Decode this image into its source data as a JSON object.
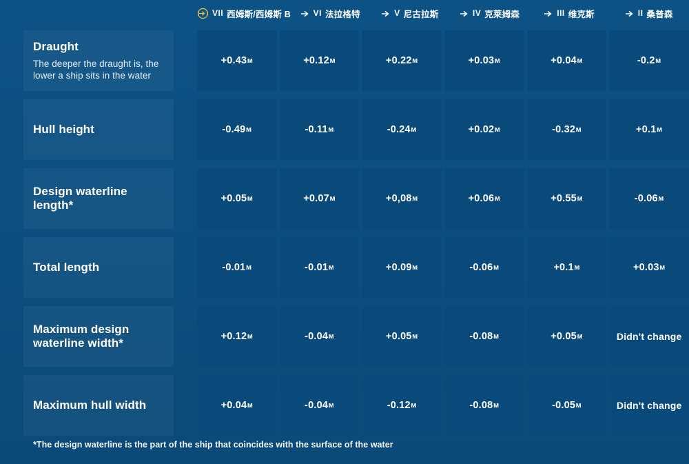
{
  "theme": {
    "background": "#0c4f80",
    "cell_background": "#0a4a7b",
    "label_background": "rgba(255,255,255,0.045)",
    "text": "#ffffff",
    "accent_gold": "#e8c14a"
  },
  "header": {
    "columns": [
      {
        "icon": "wreath-arrow-icon",
        "tier": "VII",
        "ship": "西姆斯/西姆斯 B"
      },
      {
        "icon": "arrow-right-icon",
        "tier": "VI",
        "ship": "法拉格特"
      },
      {
        "icon": "arrow-right-icon",
        "tier": "V",
        "ship": "尼古拉斯"
      },
      {
        "icon": "arrow-right-icon",
        "tier": "IV",
        "ship": "克莱姆森"
      },
      {
        "icon": "arrow-right-icon",
        "tier": "III",
        "ship": "维克斯"
      },
      {
        "icon": "arrow-right-icon",
        "tier": "II",
        "ship": "桑普森"
      }
    ]
  },
  "table": {
    "rows": [
      {
        "title": "Draught",
        "subtitle": "The deeper the draught is, the lower a ship sits in the water",
        "values": [
          "+0.43м",
          "+0.12м",
          "+0.22м",
          "+0.03м",
          "+0.04м",
          "-0.2м"
        ]
      },
      {
        "title": "Hull height",
        "subtitle": "",
        "values": [
          "-0.49м",
          "-0.11м",
          "-0.24м",
          "+0.02м",
          "-0.32м",
          "+0.1м"
        ]
      },
      {
        "title": "Design waterline length*",
        "subtitle": "",
        "values": [
          "+0.05м",
          "+0.07м",
          "+0,08м",
          "+0.06м",
          "+0.55м",
          "-0.06м"
        ]
      },
      {
        "title": "Total length",
        "subtitle": "",
        "values": [
          "-0.01м",
          "-0.01м",
          "+0.09м",
          "-0.06м",
          "+0.1м",
          "+0.03м"
        ]
      },
      {
        "title": "Maximum design waterline width*",
        "subtitle": "",
        "values": [
          "+0.12м",
          "-0.04м",
          "+0.05м",
          "-0.08м",
          "+0.05м",
          "Didn't change"
        ]
      },
      {
        "title": "Maximum hull width",
        "subtitle": "",
        "values": [
          "+0.04м",
          "-0.04м",
          "-0.12м",
          "-0.08м",
          "-0.05м",
          "Didn't change"
        ]
      }
    ]
  },
  "footnote": "*The design waterline is the part of the ship that coincides with the surface of the water"
}
